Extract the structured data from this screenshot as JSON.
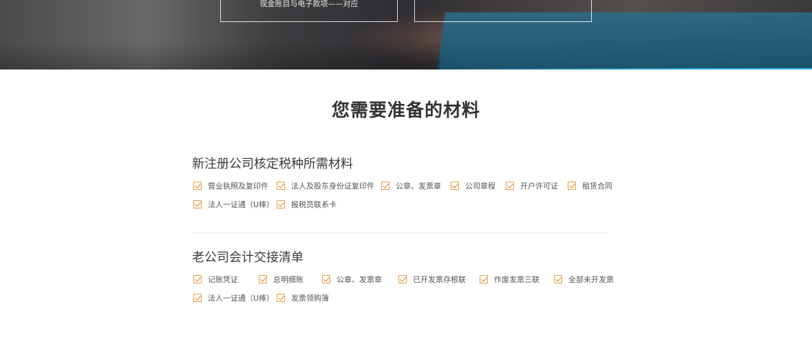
{
  "banner": {
    "left_box_text": "现金账目与电子款项——对应",
    "right_box_text": "",
    "accent_color": "#37b8ee"
  },
  "section_title": "您需要准备的材料",
  "check_color": "#e59a3f",
  "groups": [
    {
      "title": "新注册公司核定税种所需材料",
      "items": [
        "营业执照及复印件",
        "法人及股东身份证复印件",
        "公章、发票章",
        "公司章程",
        "开户许可证",
        "租赁合同",
        "法人一证通（U棒）",
        "报税员联系卡"
      ]
    },
    {
      "title": "老公司会计交接清单",
      "items": [
        "记账凭证",
        "总明细账",
        "公章、发票章",
        "已开发票存根联",
        "作废发票三联",
        "全部未开发票",
        "法人一证通（U棒）",
        "发票领购簿"
      ]
    }
  ]
}
